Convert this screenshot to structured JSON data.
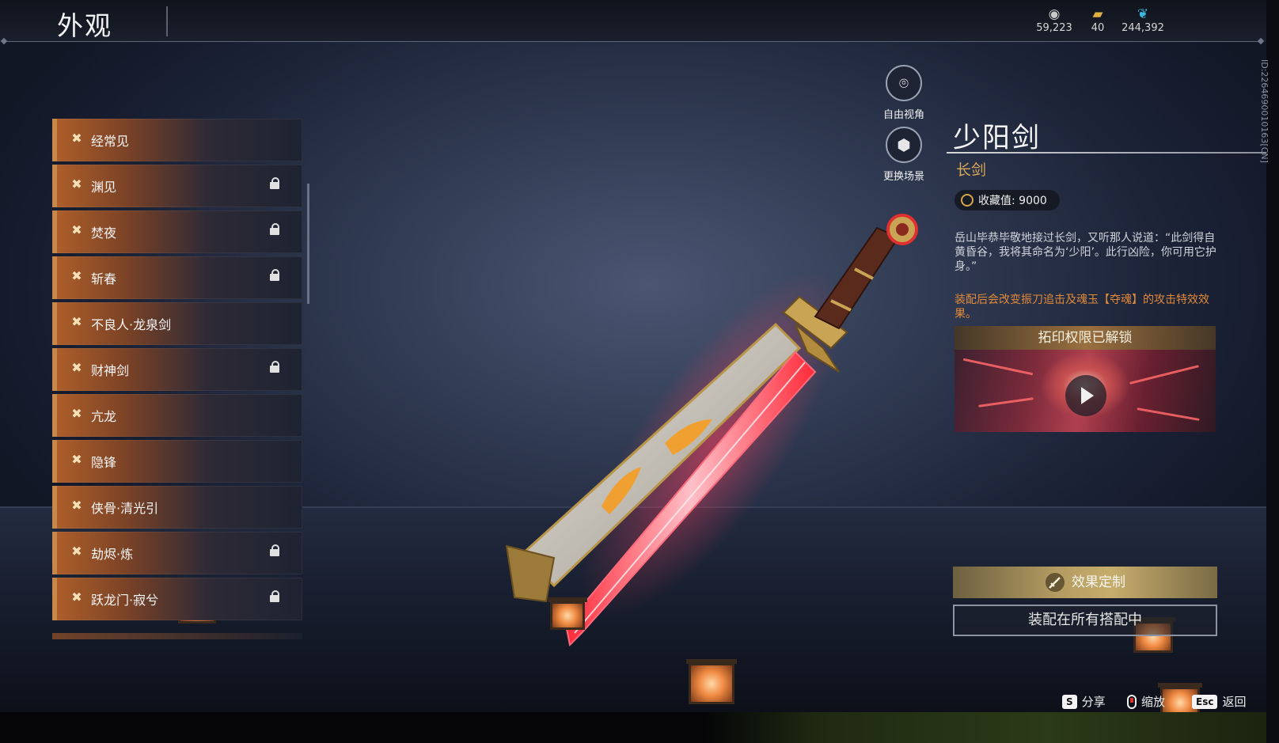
{
  "header": {
    "title": "外观",
    "currencies": [
      {
        "icon": "coin-icon",
        "value": "59,223"
      },
      {
        "icon": "ticket-icon",
        "value": "40"
      },
      {
        "icon": "feather-icon",
        "value": "244,392"
      }
    ]
  },
  "side_list": {
    "items": [
      {
        "label": "经常见",
        "locked": false
      },
      {
        "label": "渊见",
        "locked": true
      },
      {
        "label": "焚夜",
        "locked": true
      },
      {
        "label": "斩春",
        "locked": true
      },
      {
        "label": "不良人·龙泉剑",
        "locked": false
      },
      {
        "label": "财神剑",
        "locked": true
      },
      {
        "label": "亢龙",
        "locked": false
      },
      {
        "label": "隐锋",
        "locked": false
      },
      {
        "label": "侠骨·清光引",
        "locked": false
      },
      {
        "label": "劫烬·炼",
        "locked": true
      },
      {
        "label": "跃龙门·寂兮",
        "locked": true
      }
    ]
  },
  "camera": {
    "free_view": "自由视角",
    "change_scene": "更换场景"
  },
  "detail": {
    "name": "少阳剑",
    "type": "长剑",
    "collect_label": "收藏值: 9000",
    "description": "岳山毕恭毕敬地接过长剑，又听那人说道：“此剑得自黄昏谷，我将其命名为‘少阳’。此行凶险，你可用它护身。”",
    "effect": "装配后会改变振刀追击及魂玉【夺魂】的攻击特效效果。",
    "video_title": "拓印权限已解锁",
    "customize_label": "效果定制",
    "equip_label": "装配在所有搭配中",
    "id_text": "ID:2264690010163[CN]"
  },
  "hints": {
    "share_key": "S",
    "share": "分享",
    "zoom": "缩放",
    "back_key": "Esc",
    "back": "返回"
  },
  "colors": {
    "accent_gold": "#d8a85a",
    "effect_orange": "#e28a3a",
    "blade_red": "#ff4a5a"
  }
}
